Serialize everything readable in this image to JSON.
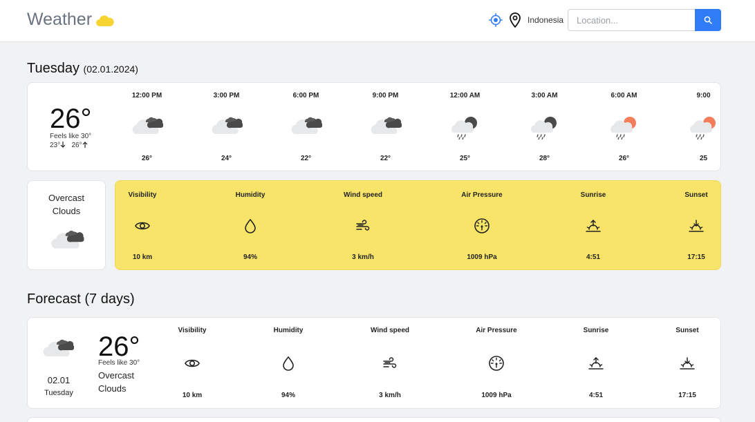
{
  "header": {
    "brand": "Weather",
    "country": "Indonesia",
    "search_placeholder": "Location...",
    "icons": [
      "cloud-icon",
      "locate-icon",
      "map-pin-icon",
      "search-icon"
    ],
    "brand_icon_color": "#f7d431",
    "accent_color": "#2f7cf6"
  },
  "today": {
    "day": "Tuesday",
    "date": "(02.01.2024)",
    "temp": "26°",
    "feels_like": "Feels like 30°",
    "min": "23°",
    "max": "26°",
    "description_line1": "Overcast",
    "description_line2": "Clouds",
    "hourly": [
      {
        "time": "12:00 PM",
        "temp": "26°",
        "icon": "overcast-clouds-icon"
      },
      {
        "time": "3:00 PM",
        "temp": "24°",
        "icon": "overcast-clouds-icon"
      },
      {
        "time": "6:00 PM",
        "temp": "22°",
        "icon": "overcast-clouds-icon"
      },
      {
        "time": "9:00 PM",
        "temp": "22°",
        "icon": "overcast-clouds-icon"
      },
      {
        "time": "12:00 AM",
        "temp": "25°",
        "icon": "rain-night-icon"
      },
      {
        "time": "3:00 AM",
        "temp": "28°",
        "icon": "rain-night-icon"
      },
      {
        "time": "6:00 AM",
        "temp": "26°",
        "icon": "rain-day-icon"
      },
      {
        "time": "9:00",
        "temp": "25",
        "icon": "rain-day-icon"
      }
    ],
    "stats": [
      {
        "label": "Visibility",
        "value": "10 km",
        "icon": "eye-icon"
      },
      {
        "label": "Humidity",
        "value": "94%",
        "icon": "droplet-icon"
      },
      {
        "label": "Wind speed",
        "value": "3 km/h",
        "icon": "wind-icon"
      },
      {
        "label": "Air Pressure",
        "value": "1009 hPa",
        "icon": "gauge-icon"
      },
      {
        "label": "Sunrise",
        "value": "4:51",
        "icon": "sunrise-icon"
      },
      {
        "label": "Sunset",
        "value": "17:15",
        "icon": "sunset-icon"
      }
    ],
    "stats_bg_color": "#f8e468"
  },
  "forecast": {
    "heading": "Forecast (7 days)",
    "days": [
      {
        "date": "02.01",
        "day": "Tuesday",
        "temp": "26°",
        "feels_like": "Feels like 30°",
        "description_line1": "Overcast",
        "description_line2": "Clouds",
        "icon": "overcast-clouds-icon",
        "stats": [
          {
            "label": "Visibility",
            "value": "10 km",
            "icon": "eye-icon"
          },
          {
            "label": "Humidity",
            "value": "94%",
            "icon": "droplet-icon"
          },
          {
            "label": "Wind speed",
            "value": "3 km/h",
            "icon": "wind-icon"
          },
          {
            "label": "Air Pressure",
            "value": "1009 hPa",
            "icon": "gauge-icon"
          },
          {
            "label": "Sunrise",
            "value": "4:51",
            "icon": "sunrise-icon"
          },
          {
            "label": "Sunset",
            "value": "17:15",
            "icon": "sunset-icon"
          }
        ]
      }
    ]
  }
}
